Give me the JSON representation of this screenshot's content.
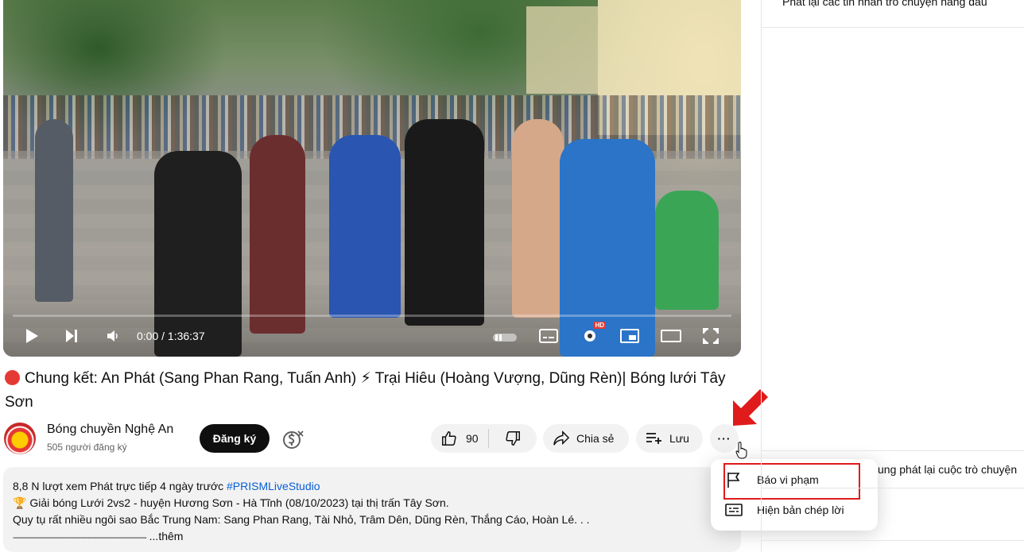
{
  "player": {
    "time": "0:00 / 1:36:37",
    "hd_badge": "HD"
  },
  "video": {
    "title": "Chung kết: An Phát (Sang Phan Rang, Tuấn Anh) ⚡ Trại Hiêu (Hoàng Vượng, Dũng Rèn)| Bóng lưới Tây Sơn"
  },
  "channel": {
    "name": "Bóng chuyền Nghệ An",
    "subscribers": "505 người đăng ký",
    "subscribe_label": "Đăng ký"
  },
  "actions": {
    "like_count": "90",
    "share_label": "Chia sẻ",
    "save_label": "Lưu",
    "more_label": "···"
  },
  "description": {
    "meta": "8,8 N lượt xem  Phát trực tiếp 4 ngày trước",
    "hashtag": "#PRISMLiveStudio",
    "line1": "🏆 Giải bóng Lưới 2vs2 - huyện Hương Sơn - Hà Tĩnh (08/10/2023) tại thị trấn Tây Sơn.",
    "line2": "Quy tụ rất nhiều ngôi sao Bắc Trung Nam: Sang Phan Rang, Tài Nhỏ, Trâm Dên, Dũng Rèn, Thắng Cáo, Hoàn Lé. . .",
    "line3_dashes": "------------------------------------------------------------------------",
    "more": "...thêm"
  },
  "menu": {
    "report_label": "Báo vi phạm",
    "transcript_label": "Hiện bản chép lời"
  },
  "chat": {
    "top_text": "Phát lại các tin nhắn trò chuyện hàng đầu",
    "bottom_text": "ung phát lại cuộc trò chuyện"
  },
  "colors": {
    "accent_red": "#e01b1b",
    "subscribe_bg": "#0f0f0f",
    "pill_bg": "#f2f2f2",
    "link_blue": "#065fd4"
  }
}
